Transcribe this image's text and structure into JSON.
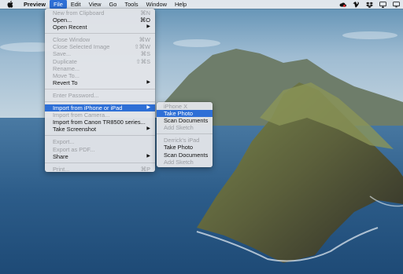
{
  "menubar": {
    "app_name": "Preview",
    "items": [
      "File",
      "Edit",
      "View",
      "Go",
      "Tools",
      "Window",
      "Help"
    ],
    "active_item": "File",
    "status_icons": [
      "creative-cloud-icon",
      "vimeo-icon",
      "dropbox-icon",
      "airplay-icon",
      "display-icon"
    ]
  },
  "file_menu": {
    "items": [
      {
        "label": "New from Clipboard",
        "shortcut": "⌘N",
        "disabled": true
      },
      {
        "label": "Open...",
        "shortcut": "⌘O",
        "disabled": false
      },
      {
        "label": "Open Recent",
        "shortcut": "",
        "submenu": true,
        "disabled": false
      },
      {
        "separator": true
      },
      {
        "label": "Close Window",
        "shortcut": "⌘W",
        "disabled": true
      },
      {
        "label": "Close Selected Image",
        "shortcut": "⇧⌘W",
        "disabled": true
      },
      {
        "label": "Save...",
        "shortcut": "⌘S",
        "disabled": true
      },
      {
        "label": "Duplicate",
        "shortcut": "⇧⌘S",
        "disabled": true
      },
      {
        "label": "Rename...",
        "shortcut": "",
        "disabled": true
      },
      {
        "label": "Move To...",
        "shortcut": "",
        "disabled": true
      },
      {
        "label": "Revert To",
        "shortcut": "",
        "submenu": true,
        "disabled": false
      },
      {
        "separator": true
      },
      {
        "label": "Enter Password...",
        "shortcut": "",
        "disabled": true
      },
      {
        "separator": true
      },
      {
        "label": "Import from iPhone or iPad",
        "shortcut": "",
        "submenu": true,
        "disabled": false,
        "highlighted": true
      },
      {
        "label": "Import from Camera...",
        "shortcut": "",
        "disabled": true
      },
      {
        "label": "Import from Canon TR8500 series...",
        "shortcut": "",
        "disabled": false
      },
      {
        "label": "Take Screenshot",
        "shortcut": "",
        "submenu": true,
        "disabled": false
      },
      {
        "separator": true
      },
      {
        "label": "Export...",
        "shortcut": "",
        "disabled": true
      },
      {
        "label": "Export as PDF...",
        "shortcut": "",
        "disabled": true
      },
      {
        "label": "Share",
        "shortcut": "",
        "submenu": true,
        "disabled": false
      },
      {
        "separator": true
      },
      {
        "label": "Print...",
        "shortcut": "⌘P",
        "disabled": true
      }
    ]
  },
  "import_submenu": {
    "items": [
      {
        "label": "iPhone X",
        "disabled": true
      },
      {
        "label": "Take Photo",
        "disabled": false,
        "highlighted": true
      },
      {
        "label": "Scan Documents",
        "disabled": false
      },
      {
        "label": "Add Sketch",
        "disabled": true
      },
      {
        "separator": true
      },
      {
        "label": "Derrick's iPad",
        "disabled": true
      },
      {
        "label": "Take Photo",
        "disabled": false
      },
      {
        "label": "Scan Documents",
        "disabled": false
      },
      {
        "label": "Add Sketch",
        "disabled": true
      }
    ]
  },
  "colors": {
    "accent": "#2e6fd6",
    "menu_bg": "#e2e4e8",
    "disabled_text": "#9b9ea3"
  }
}
